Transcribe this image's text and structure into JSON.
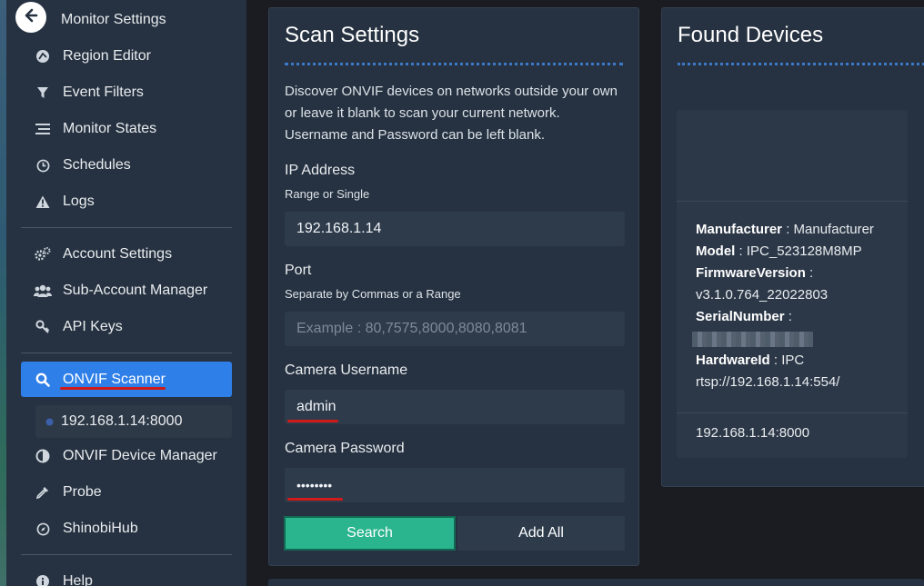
{
  "sidebar": {
    "back_icon": "arrow-left-icon",
    "items": [
      {
        "label": "Monitor Settings",
        "icon": "back-arrow"
      },
      {
        "label": "Region Editor",
        "icon": "region-icon"
      },
      {
        "label": "Event Filters",
        "icon": "filter-icon"
      },
      {
        "label": "Monitor States",
        "icon": "list-icon"
      },
      {
        "label": "Schedules",
        "icon": "clock-icon"
      },
      {
        "label": "Logs",
        "icon": "warning-icon"
      },
      {
        "label": "Account Settings",
        "icon": "cogs-icon"
      },
      {
        "label": "Sub-Account Manager",
        "icon": "users-icon"
      },
      {
        "label": "API Keys",
        "icon": "key-icon"
      },
      {
        "label": "ONVIF Scanner",
        "icon": "search-icon"
      },
      {
        "label": "192.168.1.14:8000",
        "icon": "dot-icon"
      },
      {
        "label": "ONVIF Device Manager",
        "icon": "half-circle-icon"
      },
      {
        "label": "Probe",
        "icon": "eyedropper-icon"
      },
      {
        "label": "ShinobiHub",
        "icon": "compass-icon"
      },
      {
        "label": "Help",
        "icon": "info-icon"
      }
    ],
    "active_color": "#2f7fe8"
  },
  "scan": {
    "title": "Scan Settings",
    "description": "Discover ONVIF devices on networks outside your own or leave it blank to scan your current network. Username and Password can be left blank.",
    "ip_label": "IP Address",
    "ip_hint": "Range or Single",
    "ip_value": "192.168.1.14",
    "port_label": "Port",
    "port_hint": "Separate by Commas or a Range",
    "port_placeholder": "Example : 80,7575,8000,8080,8081",
    "user_label": "Camera Username",
    "user_value": "admin",
    "pass_label": "Camera Password",
    "pass_value": "••••••••",
    "search_button": "Search",
    "search_color": "#2ab58f",
    "addall_button": "Add All"
  },
  "found": {
    "title": "Found Devices",
    "device": {
      "manufacturer_key": "Manufacturer",
      "manufacturer_value": " : Manufacturer",
      "model_key": "Model",
      "model_value": " : IPC_523128M8MP",
      "firmware_key": "FirmwareVersion",
      "firmware_value": " : v3.1.0.764_22022803",
      "serial_key": "SerialNumber",
      "serial_value": " :",
      "hardware_key": "HardwareId",
      "hardware_value": " : IPC rtsp://192.168.1.14:554/",
      "footer": "192.168.1.14:8000"
    }
  }
}
